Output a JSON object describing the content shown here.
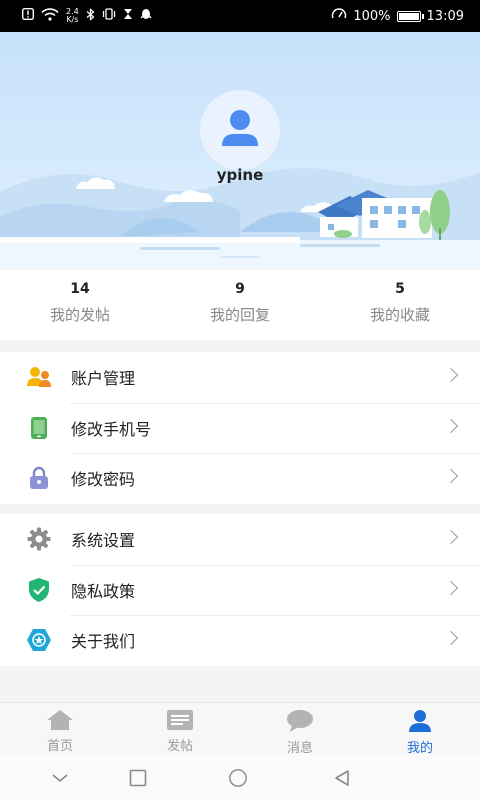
{
  "status_bar": {
    "network_speed_value": "2.4",
    "network_speed_unit": "K/s",
    "battery_percent": "100%",
    "battery_level": 1.0,
    "time": "13:09"
  },
  "profile": {
    "username": "ypine"
  },
  "stats": [
    {
      "value": "14",
      "label": "我的发帖"
    },
    {
      "value": "9",
      "label": "我的回复"
    },
    {
      "value": "5",
      "label": "我的收藏"
    }
  ],
  "menu_group_1": [
    {
      "label": "账户管理",
      "icon": "account-manage-icon"
    },
    {
      "label": "修改手机号",
      "icon": "phone-icon"
    },
    {
      "label": "修改密码",
      "icon": "lock-icon"
    }
  ],
  "menu_group_2": [
    {
      "label": "系统设置",
      "icon": "gear-icon"
    },
    {
      "label": "隐私政策",
      "icon": "shield-check-icon"
    },
    {
      "label": "关于我们",
      "icon": "about-us-icon"
    }
  ],
  "tabs": [
    {
      "label": "首页",
      "icon": "home-icon",
      "active": false
    },
    {
      "label": "发帖",
      "icon": "post-icon",
      "active": false
    },
    {
      "label": "消息",
      "icon": "message-icon",
      "active": false
    },
    {
      "label": "我的",
      "icon": "user-icon",
      "active": true
    }
  ],
  "colors": {
    "accent": "#1e6fd9",
    "header_sky": "#c6e1fb",
    "inactive_tab": "#9a9a9a"
  }
}
